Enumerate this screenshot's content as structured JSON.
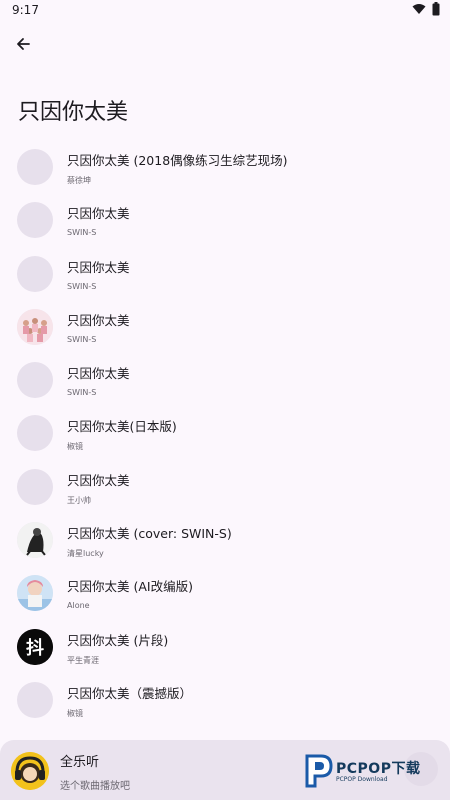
{
  "status_bar": {
    "time": "9:17"
  },
  "page": {
    "title": "只因你太美"
  },
  "songs": [
    {
      "title": "只因你太美 (2018偶像练习生综艺现场)",
      "artist": "蔡徐坤",
      "cover": "placeholder"
    },
    {
      "title": "只因你太美",
      "artist": "SWIN-S",
      "cover": "placeholder"
    },
    {
      "title": "只因你太美",
      "artist": "SWIN-S",
      "cover": "placeholder"
    },
    {
      "title": "只因你太美",
      "artist": "SWIN-S",
      "cover": "group-photo"
    },
    {
      "title": "只因你太美",
      "artist": "SWIN-S",
      "cover": "placeholder"
    },
    {
      "title": "只因你太美(日本版)",
      "artist": "椒镜",
      "cover": "placeholder"
    },
    {
      "title": "只因你太美",
      "artist": "王小帅",
      "cover": "placeholder"
    },
    {
      "title": "只因你太美 (cover: SWIN-S)",
      "artist": "清星lucky",
      "cover": "person-photo"
    },
    {
      "title": "只因你太美 (AI改编版)",
      "artist": "Alone",
      "cover": "person-photo-2"
    },
    {
      "title": "只因你太美 (片段)",
      "artist": "平生青涯",
      "cover": "douyin-logo"
    },
    {
      "title": "只因你太美（震撼版）",
      "artist": "椒镜",
      "cover": "placeholder"
    }
  ],
  "player": {
    "title": "全乐听",
    "subtitle": "选个歌曲播放吧"
  },
  "watermark": {
    "text": "PCPOP下载",
    "sub": "PCPOP Download"
  },
  "colors": {
    "background": "#fcf7fd",
    "placeholder": "#e7e0ec",
    "player_bg": "#eae3ee"
  }
}
